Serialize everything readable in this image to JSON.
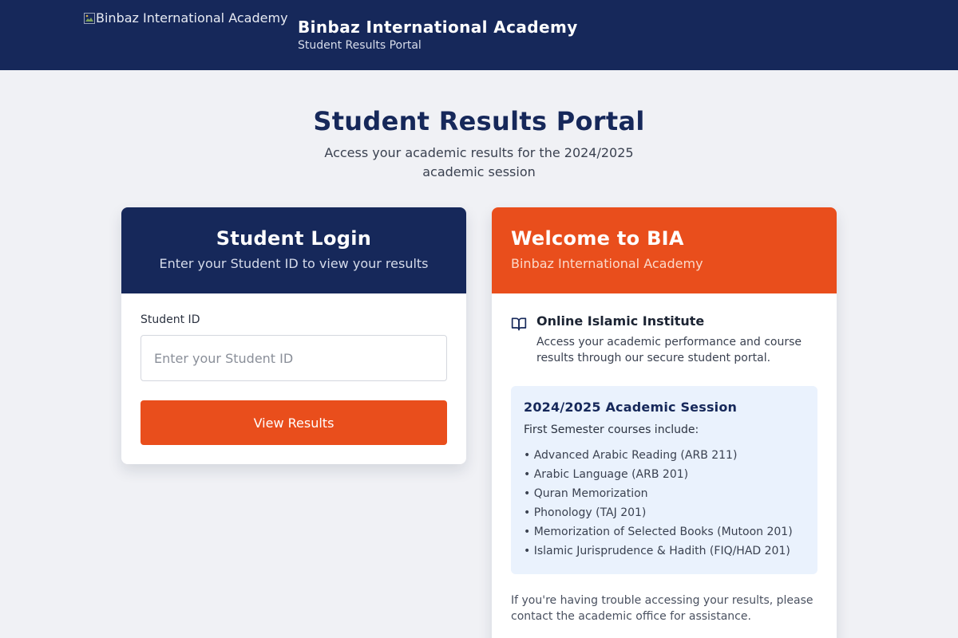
{
  "header": {
    "logo_alt": "Binbaz International Academy",
    "title": "Binbaz International Academy",
    "subtitle": "Student Results Portal"
  },
  "hero": {
    "title": "Student Results Portal",
    "subtitle": "Access your academic results for the 2024/2025 academic session"
  },
  "login": {
    "title": "Student Login",
    "subtitle": "Enter your Student ID to view your results",
    "field_label": "Student ID",
    "placeholder": "Enter your Student ID",
    "button_label": "View Results"
  },
  "welcome": {
    "title": "Welcome to BIA",
    "subtitle": "Binbaz International Academy",
    "institute_title": "Online Islamic Institute",
    "institute_desc": "Access your academic performance and course results through our secure student portal.",
    "session_title": "2024/2025 Academic Session",
    "session_intro": "First Semester courses include:",
    "courses": [
      "• Advanced Arabic Reading (ARB 211)",
      "• Arabic Language (ARB 201)",
      "• Quran Memorization",
      "• Phonology (TAJ 201)",
      "• Memorization of Selected Books (Mutoon 201)",
      "• Islamic Jurisprudence & Hadith (FIQ/HAD 201)"
    ],
    "help_text": "If you're having trouble accessing your results, please contact the academic office for assistance."
  },
  "colors": {
    "navy": "#16285a",
    "accent_orange": "#e94e1c",
    "background": "#f0f1f5",
    "session_bg": "#eaf2fd"
  },
  "icons": {
    "logo": "broken-image-icon",
    "institute": "book-open-icon"
  }
}
